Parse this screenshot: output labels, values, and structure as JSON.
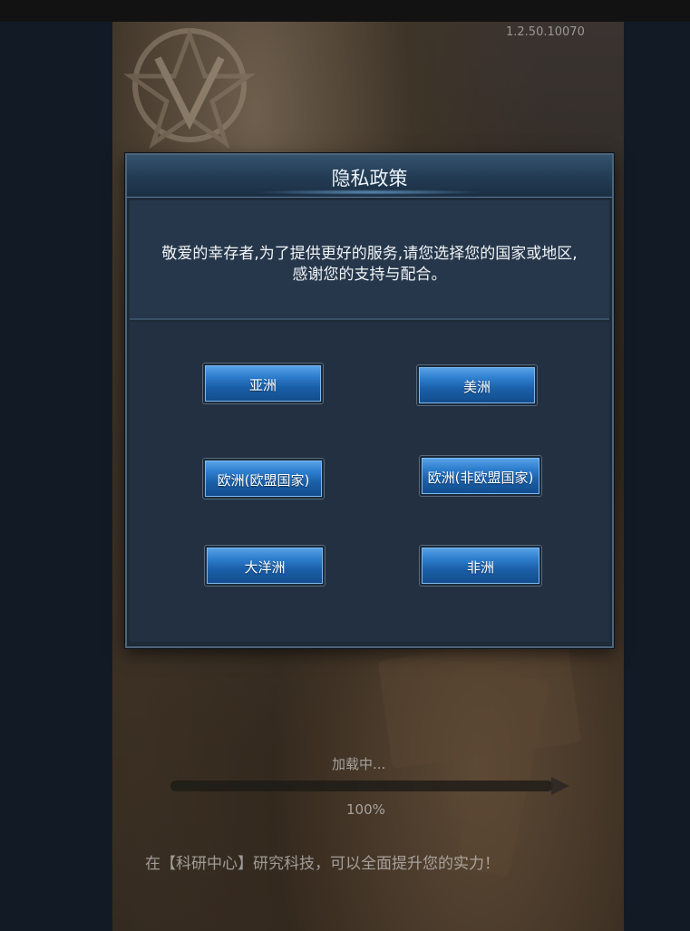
{
  "game": {
    "version": "1.2.50.10070",
    "loading_label": "加载中...",
    "loading_percent": "100%",
    "tip": "在【科研中心】研究科技，可以全面提升您的实力！"
  },
  "dialog": {
    "title": "隐私政策",
    "message_line1": "敬爱的幸存者,为了提供更好的服务,请您选择您的国家或地区,",
    "message_line2": "感谢您的支持与配合。",
    "regions": {
      "asia": "亚洲",
      "americas": "美洲",
      "europe_eu": "欧洲(欧盟国家)",
      "europe_non_eu": "欧洲(非欧盟国家)",
      "oceania": "大洋洲",
      "africa": "非洲"
    }
  },
  "colors": {
    "button_blue": "#2f7fd0",
    "dialog_bg": "#1d2a38",
    "header_bg": "#223b53"
  }
}
